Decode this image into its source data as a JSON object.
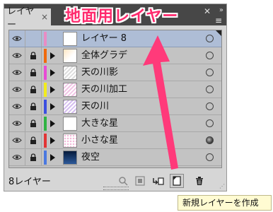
{
  "panel": {
    "tab_label": "レイヤー",
    "tab_close": "×",
    "title_close": "✕",
    "collapse": "»",
    "menu_icon": "≡"
  },
  "annotation": {
    "text": "地面用レイヤー",
    "color": "#ff2a6d"
  },
  "layers": [
    {
      "name": "レイヤー 8",
      "color": "#e98cc4",
      "locked": false,
      "expandable": false,
      "selected": true,
      "target": "empty",
      "thumb": "white"
    },
    {
      "name": "全体グラデ",
      "color": "#f06a0c",
      "locked": true,
      "expandable": true,
      "selected": false,
      "target": "empty",
      "thumb": "gradient-orange"
    },
    {
      "name": "天の川影",
      "color": "#e84ad5",
      "locked": true,
      "expandable": true,
      "selected": false,
      "target": "empty",
      "thumb": "stripes-gray"
    },
    {
      "name": "天の川加工",
      "color": "#f2ec1a",
      "locked": true,
      "expandable": true,
      "selected": false,
      "target": "empty",
      "thumb": "stripes-pink"
    },
    {
      "name": "天の川",
      "color": "#3c4fe0",
      "locked": true,
      "expandable": true,
      "selected": false,
      "target": "empty",
      "thumb": "stripes-purple"
    },
    {
      "name": "大きな星",
      "color": "#2fb342",
      "locked": true,
      "expandable": true,
      "selected": false,
      "target": "empty",
      "thumb": "white"
    },
    {
      "name": "小さな星",
      "color": "#e23434",
      "locked": true,
      "expandable": true,
      "selected": false,
      "target": "filled",
      "thumb": "dots-pink"
    },
    {
      "name": "夜空",
      "color": "#4a78e0",
      "locked": true,
      "expandable": true,
      "selected": false,
      "target": "empty",
      "thumb": "night-sky"
    }
  ],
  "footer": {
    "layer_count": "8レイヤー",
    "buttons": [
      "locate-object-icon",
      "make-clipping-mask-icon",
      "create-sublayer-icon",
      "create-new-layer-icon",
      "trash-icon"
    ]
  },
  "tooltip": {
    "text": "新規レイヤーを作成"
  }
}
